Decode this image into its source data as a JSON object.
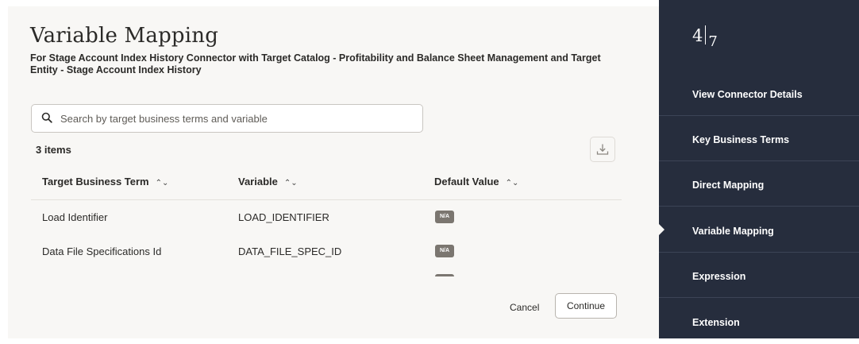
{
  "dialog": {
    "title": "Variable Mapping",
    "subtitle": "For Stage Account Index History Connector with Target Catalog - Profitability and Balance Sheet Management and Target Entity - Stage Account Index History"
  },
  "search": {
    "placeholder": "Search by target business terms and variable",
    "value": "",
    "icon": "search-icon"
  },
  "table": {
    "count_label": "3 items",
    "download_icon": "download-icon",
    "columns": [
      "Target Business Term",
      "Variable",
      "Default Value"
    ],
    "rows": [
      {
        "term": "Load Identifier",
        "variable": "LOAD_IDENTIFIER",
        "default": "N/A"
      },
      {
        "term": "Data File Specifications Id",
        "variable": "DATA_FILE_SPEC_ID",
        "default": "N/A"
      }
    ]
  },
  "footer": {
    "cancel_label": "Cancel",
    "continue_label": "Continue"
  },
  "sidebar": {
    "step_current": "4",
    "step_total": "7",
    "items": [
      {
        "label": "View Connector Details",
        "active": false
      },
      {
        "label": "Key Business Terms",
        "active": false
      },
      {
        "label": "Direct Mapping",
        "active": false
      },
      {
        "label": "Variable Mapping",
        "active": true
      },
      {
        "label": "Expression",
        "active": false
      },
      {
        "label": "Extension",
        "active": false
      }
    ]
  },
  "colors": {
    "sidebar_bg": "#262d3d",
    "content_bg": "#f8f7f5",
    "badge_bg": "#7b7670"
  }
}
